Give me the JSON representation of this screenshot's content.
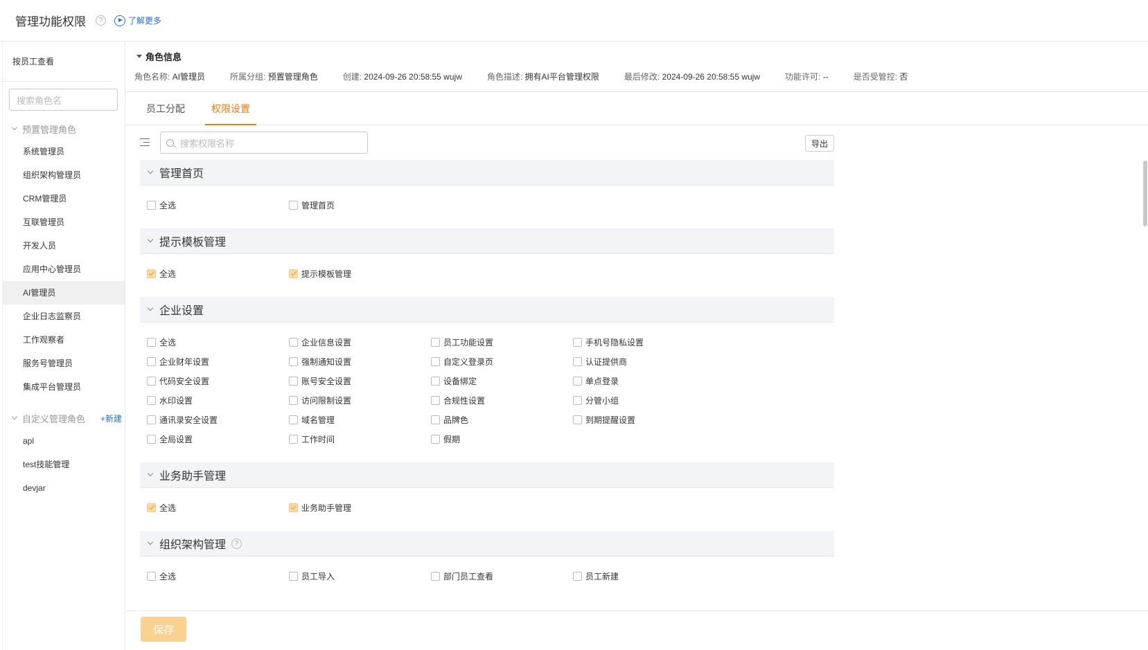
{
  "header": {
    "title": "管理功能权限",
    "help": "?",
    "learn_more": "了解更多"
  },
  "sidebar": {
    "view_by_employee": "按员工查看",
    "search_placeholder": "搜索角色名",
    "preset_group": "预置管理角色",
    "preset_roles": [
      "系统管理员",
      "组织架构管理员",
      "CRM管理员",
      "互联管理员",
      "开发人员",
      "应用中心管理员",
      "AI管理员",
      "企业日志监察员",
      "工作观察者",
      "服务号管理员",
      "集成平台管理员"
    ],
    "active_role": "AI管理员",
    "custom_group": "自定义管理角色",
    "new_link": "+新建",
    "custom_roles": [
      "apl",
      "test技能管理",
      "devjar"
    ]
  },
  "role_info": {
    "title": "角色信息",
    "fields": [
      {
        "k": "角色名称:",
        "v": "AI管理员"
      },
      {
        "k": "所属分组:",
        "v": "预置管理角色"
      },
      {
        "k": "创建:",
        "v": "2024-09-26 20:58:55 wujw"
      },
      {
        "k": "角色描述:",
        "v": "拥有AI平台管理权限"
      },
      {
        "k": "最后修改:",
        "v": "2024-09-26 20:58:55 wujw"
      },
      {
        "k": "功能许可:",
        "v": "--"
      },
      {
        "k": "是否受管控:",
        "v": "否"
      }
    ]
  },
  "tabs": [
    {
      "label": "员工分配",
      "active": false
    },
    {
      "label": "权限设置",
      "active": true
    }
  ],
  "toolbar": {
    "search_placeholder": "搜索权限名称",
    "export": "导出"
  },
  "sections": [
    {
      "title": "管理首页",
      "help": false,
      "items": [
        {
          "label": "全选",
          "checked": false
        },
        {
          "label": "管理首页",
          "checked": false
        }
      ]
    },
    {
      "title": "提示模板管理",
      "help": false,
      "items": [
        {
          "label": "全选",
          "checked": true
        },
        {
          "label": "提示模板管理",
          "checked": true
        }
      ]
    },
    {
      "title": "企业设置",
      "help": false,
      "items": [
        {
          "label": "全选",
          "checked": false
        },
        {
          "label": "企业信息设置",
          "checked": false
        },
        {
          "label": "员工功能设置",
          "checked": false
        },
        {
          "label": "手机号隐私设置",
          "checked": false
        },
        {
          "label": "企业财年设置",
          "checked": false
        },
        {
          "label": "强制通知设置",
          "checked": false
        },
        {
          "label": "自定义登录页",
          "checked": false
        },
        {
          "label": "认证提供商",
          "checked": false
        },
        {
          "label": "代码安全设置",
          "checked": false
        },
        {
          "label": "账号安全设置",
          "checked": false
        },
        {
          "label": "设备绑定",
          "checked": false
        },
        {
          "label": "单点登录",
          "checked": false
        },
        {
          "label": "水印设置",
          "checked": false
        },
        {
          "label": "访问限制设置",
          "checked": false
        },
        {
          "label": "合规性设置",
          "checked": false
        },
        {
          "label": "分管小组",
          "checked": false
        },
        {
          "label": "通讯录安全设置",
          "checked": false
        },
        {
          "label": "域名管理",
          "checked": false
        },
        {
          "label": "品牌色",
          "checked": false
        },
        {
          "label": "到期提醒设置",
          "checked": false
        },
        {
          "label": "全局设置",
          "checked": false
        },
        {
          "label": "工作时间",
          "checked": false
        },
        {
          "label": "假期",
          "checked": false
        }
      ]
    },
    {
      "title": "业务助手管理",
      "help": false,
      "items": [
        {
          "label": "全选",
          "checked": true
        },
        {
          "label": "业务助手管理",
          "checked": true
        }
      ]
    },
    {
      "title": "组织架构管理",
      "help": true,
      "items": [
        {
          "label": "全选",
          "checked": false
        },
        {
          "label": "员工导入",
          "checked": false
        },
        {
          "label": "部门员工查看",
          "checked": false
        },
        {
          "label": "员工新建",
          "checked": false
        }
      ]
    }
  ],
  "footer": {
    "save": "保存"
  },
  "colors": {
    "accent": "#f27d16",
    "link": "#2b6fd6",
    "save_bg": "#fbd18f",
    "checked_bg": "#fbdba9"
  }
}
